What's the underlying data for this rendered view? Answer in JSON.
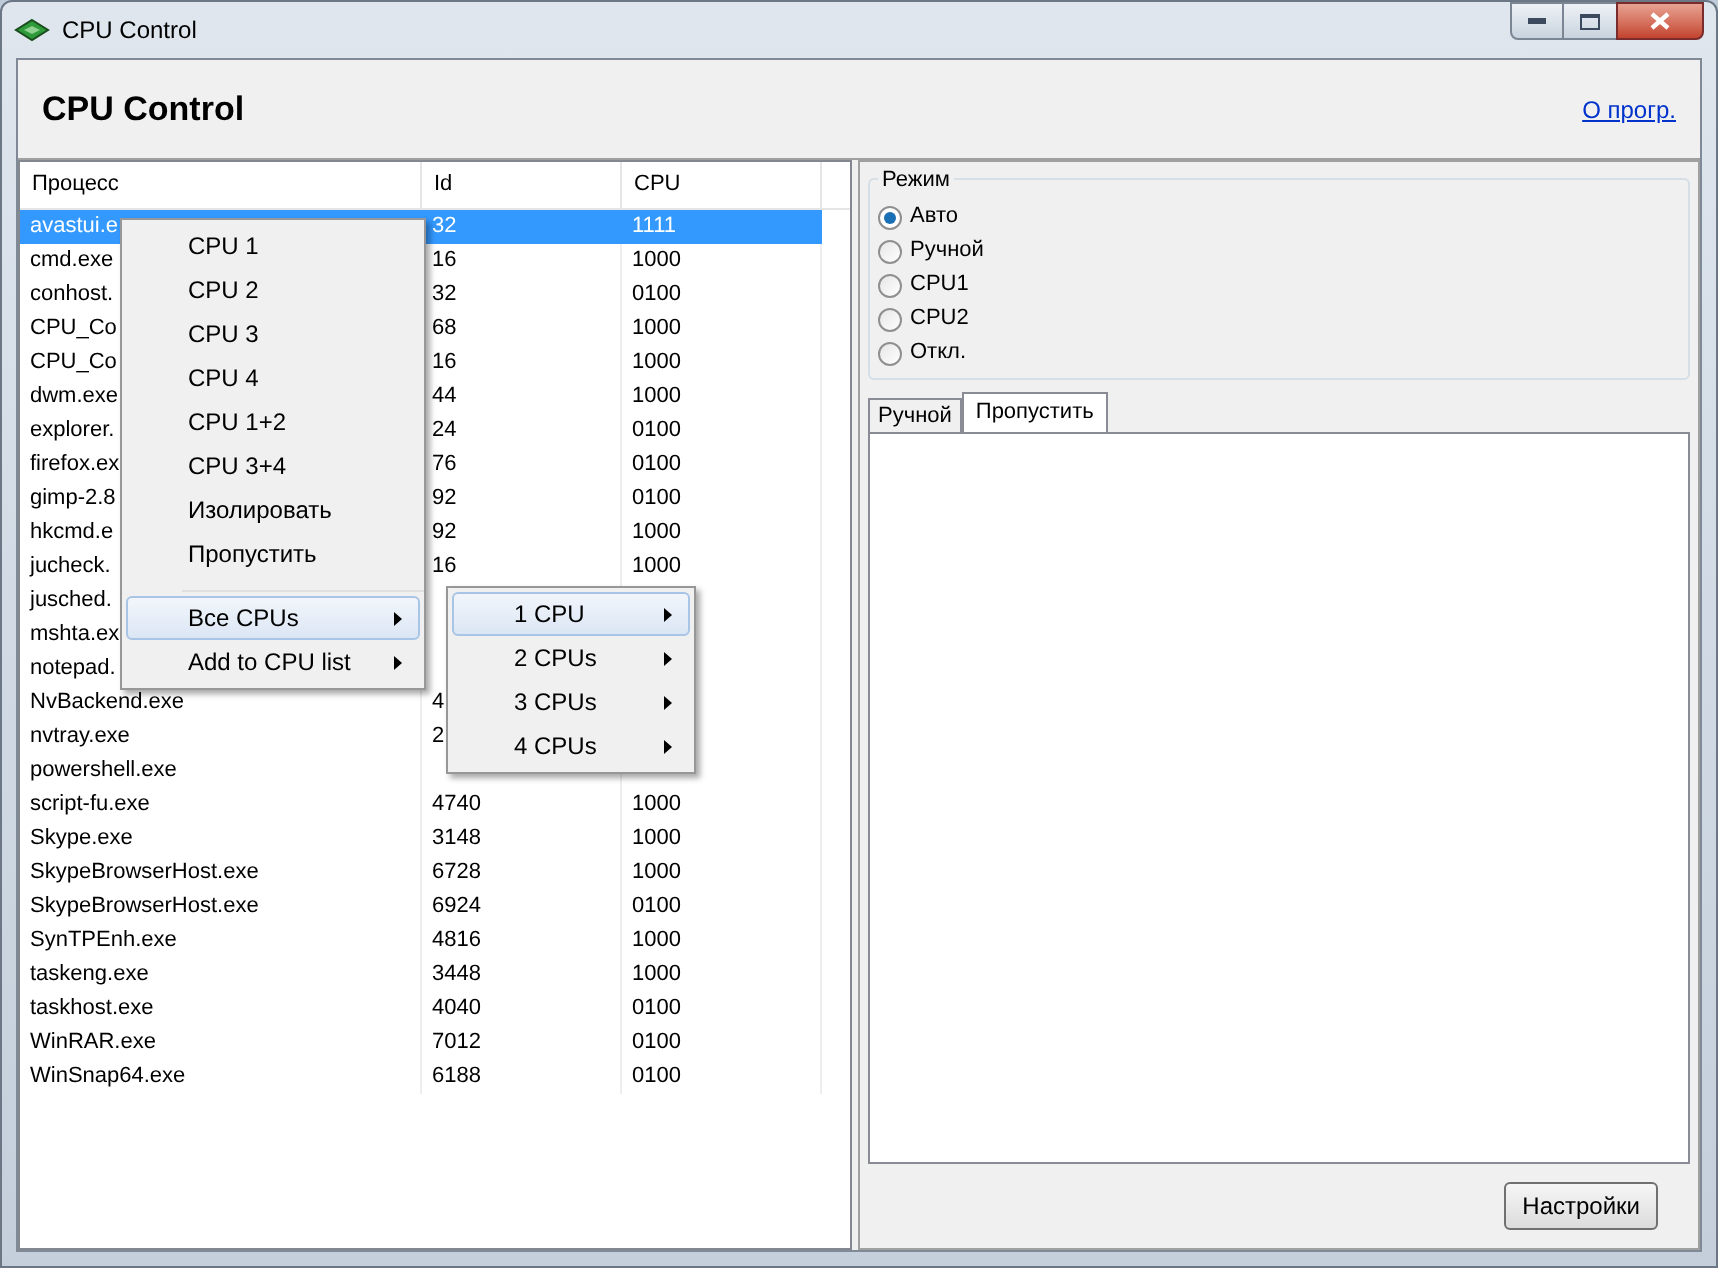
{
  "window": {
    "title": "CPU Control"
  },
  "header": {
    "title": "CPU Control",
    "link": "О прогр."
  },
  "table": {
    "columns": [
      "Процесс",
      "Id",
      "CPU"
    ],
    "rows": [
      {
        "name": "avastui.e",
        "id": "32",
        "cpu": "1111",
        "selected": true
      },
      {
        "name": "cmd.exe",
        "id": "16",
        "cpu": "1000",
        "selected": false
      },
      {
        "name": "conhost.",
        "id": "32",
        "cpu": "0100",
        "selected": false
      },
      {
        "name": "CPU_Co",
        "id": "68",
        "cpu": "1000",
        "selected": false
      },
      {
        "name": "CPU_Co",
        "id": "16",
        "cpu": "1000",
        "selected": false
      },
      {
        "name": "dwm.exe",
        "id": "44",
        "cpu": "1000",
        "selected": false
      },
      {
        "name": "explorer.",
        "id": "24",
        "cpu": "0100",
        "selected": false
      },
      {
        "name": "firefox.ex",
        "id": "76",
        "cpu": "0100",
        "selected": false
      },
      {
        "name": "gimp-2.8",
        "id": "92",
        "cpu": "0100",
        "selected": false
      },
      {
        "name": "hkcmd.e",
        "id": "92",
        "cpu": "1000",
        "selected": false
      },
      {
        "name": "jucheck.",
        "id": "16",
        "cpu": "1000",
        "selected": false
      },
      {
        "name": "jusched.",
        "selected": false
      },
      {
        "name": "mshta.ex",
        "selected": false
      },
      {
        "name": "notepad.",
        "selected": false
      },
      {
        "name": "NvBackend.exe",
        "id": "4",
        "selected": false
      },
      {
        "name": "nvtray.exe",
        "id": "2",
        "selected": false
      },
      {
        "name": "powershell.exe",
        "selected": false
      },
      {
        "name": "script-fu.exe",
        "id": "4740",
        "cpu": "1000",
        "selected": false
      },
      {
        "name": "Skype.exe",
        "id": "3148",
        "cpu": "1000",
        "selected": false
      },
      {
        "name": "SkypeBrowserHost.exe",
        "id": "6728",
        "cpu": "1000",
        "selected": false
      },
      {
        "name": "SkypeBrowserHost.exe",
        "id": "6924",
        "cpu": "0100",
        "selected": false
      },
      {
        "name": "SynTPEnh.exe",
        "id": "4816",
        "cpu": "1000",
        "selected": false
      },
      {
        "name": "taskeng.exe",
        "id": "3448",
        "cpu": "1000",
        "selected": false
      },
      {
        "name": "taskhost.exe",
        "id": "4040",
        "cpu": "0100",
        "selected": false
      },
      {
        "name": "WinRAR.exe",
        "id": "7012",
        "cpu": "0100",
        "selected": false
      },
      {
        "name": "WinSnap64.exe",
        "id": "6188",
        "cpu": "0100",
        "selected": false
      }
    ]
  },
  "context_menu": {
    "items": [
      {
        "label": "CPU 1",
        "kind": "item",
        "selected": false
      },
      {
        "label": "CPU 2",
        "kind": "item",
        "selected": false
      },
      {
        "label": "CPU 3",
        "kind": "item",
        "selected": false
      },
      {
        "label": "CPU 4",
        "kind": "item",
        "selected": false
      },
      {
        "label": "CPU 1+2",
        "kind": "item",
        "selected": false
      },
      {
        "label": "CPU 3+4",
        "kind": "item",
        "selected": false
      },
      {
        "label": "Изолировать",
        "kind": "item",
        "selected": false
      },
      {
        "label": "Пропустить",
        "kind": "item",
        "selected": false
      },
      {
        "kind": "separator"
      },
      {
        "label": "Все CPUs",
        "kind": "submenu",
        "selected": true
      },
      {
        "label": "Add to CPU list",
        "kind": "submenu",
        "selected": false
      }
    ]
  },
  "submenu": {
    "items": [
      {
        "label": "1 CPU",
        "kind": "submenu",
        "selected": true
      },
      {
        "label": "2 CPUs",
        "kind": "submenu",
        "selected": false
      },
      {
        "label": "3 CPUs",
        "kind": "submenu",
        "selected": false
      },
      {
        "label": "4 CPUs",
        "kind": "submenu",
        "selected": false
      }
    ]
  },
  "mode": {
    "title": "Режим",
    "options": [
      {
        "label": "Авто",
        "selected": true
      },
      {
        "label": "Ручной",
        "selected": false
      },
      {
        "label": "CPU1",
        "selected": false
      },
      {
        "label": "CPU2",
        "selected": false
      },
      {
        "label": "Откл.",
        "selected": false
      }
    ]
  },
  "tabs": [
    {
      "label": "Ручной",
      "selected": false
    },
    {
      "label": "Пропустить",
      "selected": true
    }
  ],
  "buttons": [
    "Настройки"
  ]
}
